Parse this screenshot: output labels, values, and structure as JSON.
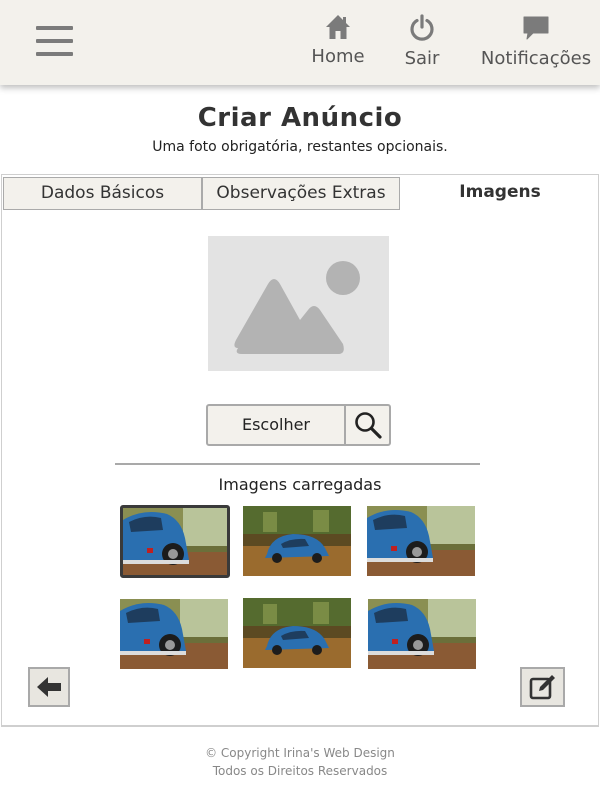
{
  "header": {
    "nav": [
      {
        "label": "Home",
        "icon": "home-icon"
      },
      {
        "label": "Sair",
        "icon": "power-icon"
      },
      {
        "label": "Notificações",
        "icon": "chat-bubble-icon"
      }
    ]
  },
  "page": {
    "title": "Criar Anúncio",
    "subtitle": "Uma foto obrigatória, restantes opcionais."
  },
  "tabs": [
    {
      "label": "Dados Básicos",
      "active": false
    },
    {
      "label": "Observações Extras",
      "active": false
    },
    {
      "label": "Imagens",
      "active": true
    }
  ],
  "upload": {
    "choose_label": "Escolher",
    "uploaded_label": "Imagens carregadas",
    "thumbnails": [
      {
        "variant": "closeup",
        "selected": true
      },
      {
        "variant": "wide",
        "selected": false
      },
      {
        "variant": "closeup",
        "selected": false
      },
      {
        "variant": "closeup",
        "selected": false
      },
      {
        "variant": "wide",
        "selected": false
      },
      {
        "variant": "closeup",
        "selected": false
      }
    ]
  },
  "footer": {
    "line1": "© Copyright Irina's Web Design",
    "line2": "Todos os Direitos Reservados"
  },
  "colors": {
    "header_bg": "#f3f1ec",
    "icon_gray": "#7b7b7b",
    "button_border": "#a9a9a9",
    "car_blue": "#2a6fb0"
  }
}
